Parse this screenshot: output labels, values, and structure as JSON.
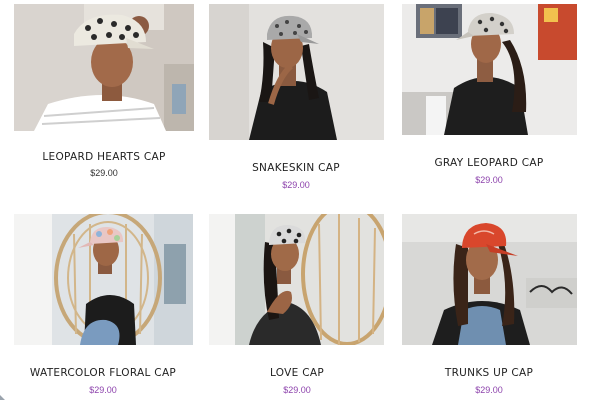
{
  "products": [
    {
      "name": "LEOPARD HEARTS CAP",
      "price": "$29.00",
      "price_color": "#333333",
      "image": "woman-leopard-hearts-cap-photo"
    },
    {
      "name": "SNAKESKIN CAP",
      "price": "$29.00",
      "price_color": "#8e44ad",
      "image": "woman-snakeskin-cap-photo"
    },
    {
      "name": "GRAY LEOPARD CAP",
      "price": "$29.00",
      "price_color": "#8e44ad",
      "image": "woman-gray-leopard-cap-photo"
    },
    {
      "name": "WATERCOLOR FLORAL CAP",
      "price": "$29.00",
      "price_color": "#8e44ad",
      "image": "woman-watercolor-floral-cap-photo"
    },
    {
      "name": "LOVE CAP",
      "price": "$29.00",
      "price_color": "#8e44ad",
      "image": "woman-love-cap-photo"
    },
    {
      "name": "TRUNKS UP CAP",
      "price": "$29.00",
      "price_color": "#8e44ad",
      "image": "woman-trunks-up-cap-photo"
    }
  ],
  "colors": {
    "price_accent": "#8e44ad",
    "price_dark": "#333333",
    "title": "#222222"
  }
}
